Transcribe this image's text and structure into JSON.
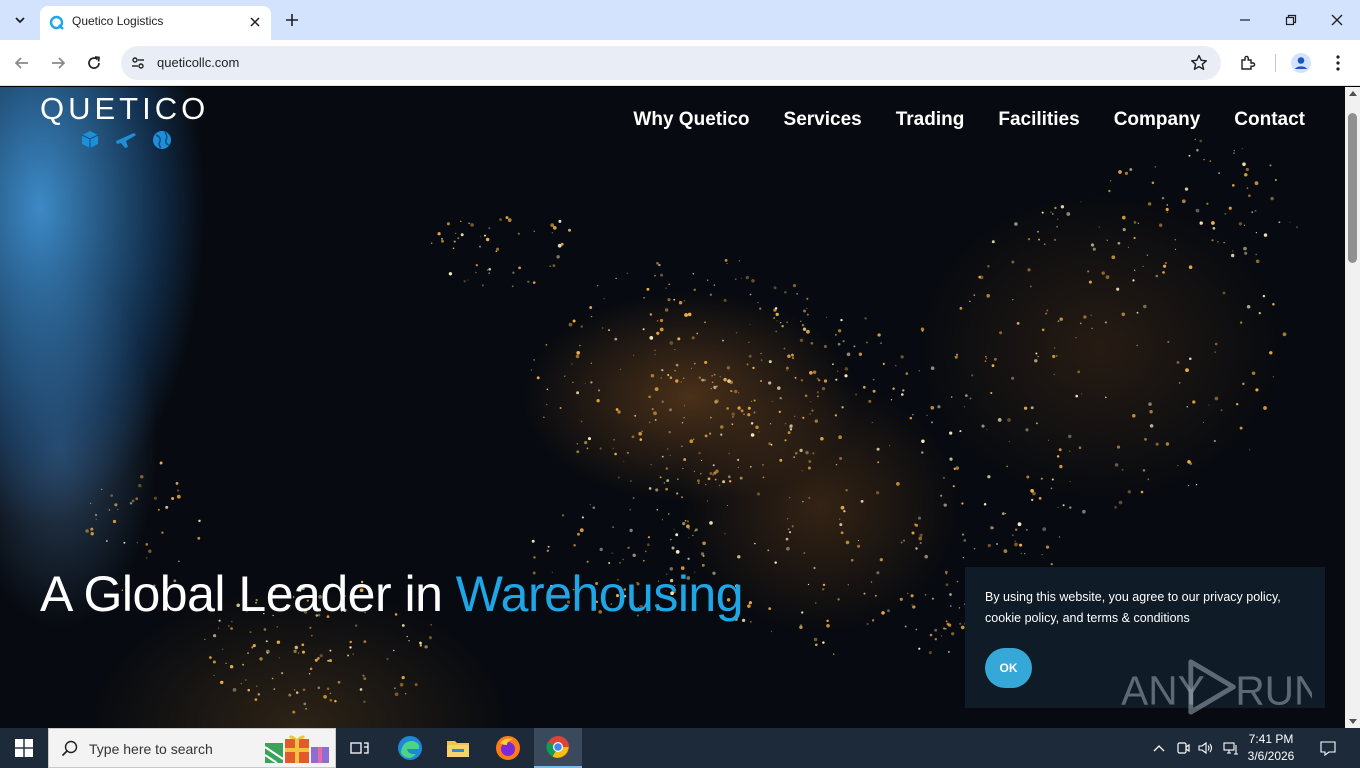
{
  "browser": {
    "tab_title": "Quetico Logistics",
    "url": "queticollc.com"
  },
  "site": {
    "logo_text": "QUETICO",
    "nav": [
      "Why Quetico",
      "Services",
      "Trading",
      "Facilities",
      "Company",
      "Contact"
    ],
    "hero_prefix": "A Global Leader in ",
    "hero_accent": "Warehousing",
    "accent_color": "#1ea6e6"
  },
  "cookie": {
    "text": "By using this website, you agree to our privacy policy, cookie policy, and terms & conditions",
    "ok_label": "OK"
  },
  "watermark": "ANY RUN",
  "taskbar": {
    "search_placeholder": "Type here to search",
    "time": "7:41 PM",
    "date": "3/6/2026"
  }
}
